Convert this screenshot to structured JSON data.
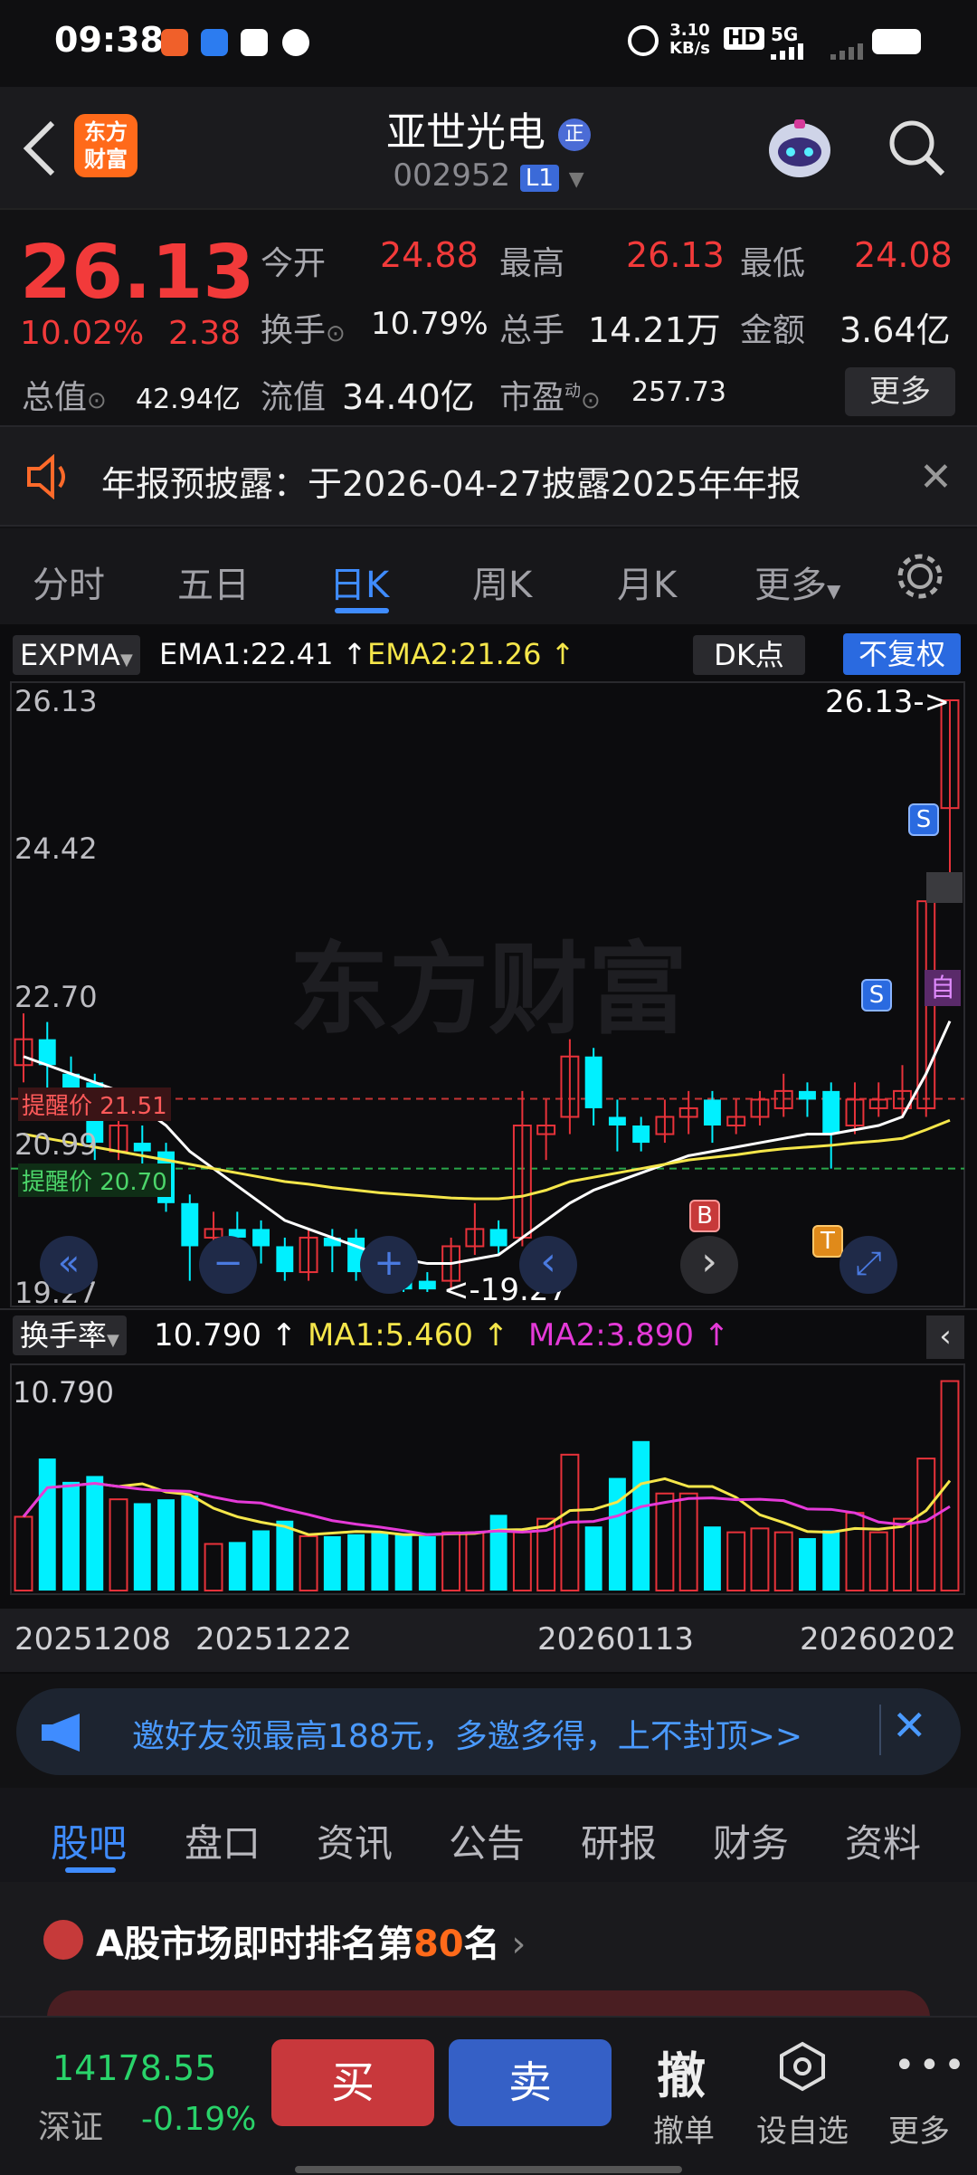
{
  "status_bar": {
    "time": "09:38",
    "net_speed_value": "3.10",
    "net_speed_unit": "KB/s",
    "hd": "HD",
    "signal": "5G"
  },
  "header": {
    "logo_line1": "东方",
    "logo_line2": "财富",
    "stock_name": "亚世光电",
    "badge": "正",
    "stock_code": "002952",
    "level": "L1"
  },
  "quote": {
    "price": "26.13",
    "change_pct": "10.02%",
    "change": "2.38",
    "open_label": "今开",
    "open": "24.88",
    "high_label": "最高",
    "high": "26.13",
    "low_label": "最低",
    "low": "24.08",
    "turnover_label": "换手",
    "turnover": "10.79%",
    "volume_label": "总手",
    "volume": "14.21万",
    "amount_label": "金额",
    "amount": "3.64亿",
    "mktcap_label": "总值",
    "mktcap": "42.94亿",
    "float_label": "流值",
    "float_cap": "34.40亿",
    "pe_label": "市盈",
    "pe_sup": "动",
    "pe": "257.73",
    "more_btn": "更多"
  },
  "notice": {
    "text": "年报预披露：于2026-04-27披露2025年年报"
  },
  "kline_tabs": [
    "分时",
    "五日",
    "日K",
    "周K",
    "月K",
    "更多"
  ],
  "kline_active": 2,
  "indicator": {
    "name": "EXPMA",
    "ema1": "EMA1:22.41",
    "ema2": "EMA2:21.26",
    "dk_label": "DK点",
    "adjust": "不复权",
    "price_ticks": [
      "26.13",
      "24.42",
      "22.70",
      "20.99",
      "19.27"
    ],
    "last_price_label": "26.13->",
    "min_label": "<-19.27",
    "alert1": "提醒价 21.51",
    "alert2": "提醒价 20.70",
    "watermark": "东方财富",
    "signal_labels": {
      "s": "S",
      "b": "B",
      "t": "T",
      "self": "自"
    },
    "colors": {
      "up": "#e8323a",
      "down": "#00f0ff",
      "ema1": "#ffffff",
      "ema2": "#f5e64a",
      "ma2": "#e53ad8"
    }
  },
  "sub_indicator": {
    "name": "换手率",
    "value": "10.790",
    "ma1": "MA1:5.460",
    "ma2": "MA2:3.890",
    "top_label": "10.790",
    "dates": [
      "20251208",
      "20251222",
      "20260113",
      "20260202"
    ]
  },
  "chart_data": {
    "type": "candlestick",
    "ylim": [
      19.27,
      26.13
    ],
    "candles": [
      {
        "o": 21.9,
        "c": 22.2,
        "h": 22.5,
        "l": 21.7
      },
      {
        "o": 22.2,
        "c": 21.9,
        "h": 22.4,
        "l": 21.6
      },
      {
        "o": 21.8,
        "c": 21.6,
        "h": 22.0,
        "l": 21.5
      },
      {
        "o": 21.7,
        "c": 21.0,
        "h": 21.8,
        "l": 20.8
      },
      {
        "o": 20.9,
        "c": 21.2,
        "h": 21.4,
        "l": 20.8
      },
      {
        "o": 21.0,
        "c": 20.9,
        "h": 21.2,
        "l": 20.7
      },
      {
        "o": 20.9,
        "c": 20.3,
        "h": 21.0,
        "l": 20.2
      },
      {
        "o": 20.3,
        "c": 19.8,
        "h": 20.4,
        "l": 19.4
      },
      {
        "o": 19.9,
        "c": 20.0,
        "h": 20.2,
        "l": 19.7
      },
      {
        "o": 20.0,
        "c": 19.9,
        "h": 20.2,
        "l": 19.7
      },
      {
        "o": 20.0,
        "c": 19.8,
        "h": 20.1,
        "l": 19.6
      },
      {
        "o": 19.8,
        "c": 19.5,
        "h": 19.9,
        "l": 19.4
      },
      {
        "o": 19.5,
        "c": 19.9,
        "h": 20.0,
        "l": 19.4
      },
      {
        "o": 19.9,
        "c": 19.8,
        "h": 20.0,
        "l": 19.5
      },
      {
        "o": 19.9,
        "c": 19.5,
        "h": 20.0,
        "l": 19.4
      },
      {
        "o": 19.6,
        "c": 19.5,
        "h": 19.7,
        "l": 19.3
      },
      {
        "o": 19.6,
        "c": 19.3,
        "h": 19.7,
        "l": 19.27
      },
      {
        "o": 19.4,
        "c": 19.3,
        "h": 19.5,
        "l": 19.27
      },
      {
        "o": 19.4,
        "c": 19.8,
        "h": 19.9,
        "l": 19.3
      },
      {
        "o": 19.8,
        "c": 20.0,
        "h": 20.3,
        "l": 19.7
      },
      {
        "o": 20.0,
        "c": 19.8,
        "h": 20.1,
        "l": 19.7
      },
      {
        "o": 19.9,
        "c": 21.2,
        "h": 21.6,
        "l": 19.8
      },
      {
        "o": 21.1,
        "c": 21.2,
        "h": 21.5,
        "l": 20.8
      },
      {
        "o": 21.3,
        "c": 22.0,
        "h": 22.2,
        "l": 21.1
      },
      {
        "o": 22.0,
        "c": 21.4,
        "h": 22.1,
        "l": 21.2
      },
      {
        "o": 21.3,
        "c": 21.2,
        "h": 21.5,
        "l": 20.9
      },
      {
        "o": 21.2,
        "c": 21.0,
        "h": 21.3,
        "l": 20.9
      },
      {
        "o": 21.1,
        "c": 21.3,
        "h": 21.5,
        "l": 21.0
      },
      {
        "o": 21.3,
        "c": 21.4,
        "h": 21.6,
        "l": 21.1
      },
      {
        "o": 21.5,
        "c": 21.2,
        "h": 21.6,
        "l": 21.0
      },
      {
        "o": 21.2,
        "c": 21.3,
        "h": 21.5,
        "l": 21.1
      },
      {
        "o": 21.3,
        "c": 21.5,
        "h": 21.6,
        "l": 21.2
      },
      {
        "o": 21.4,
        "c": 21.6,
        "h": 21.8,
        "l": 21.3
      },
      {
        "o": 21.6,
        "c": 21.5,
        "h": 21.7,
        "l": 21.3
      },
      {
        "o": 21.6,
        "c": 21.1,
        "h": 21.7,
        "l": 20.7
      },
      {
        "o": 21.2,
        "c": 21.5,
        "h": 21.7,
        "l": 21.1
      },
      {
        "o": 21.4,
        "c": 21.5,
        "h": 21.7,
        "l": 21.3
      },
      {
        "o": 21.4,
        "c": 21.6,
        "h": 21.9,
        "l": 21.3
      },
      {
        "o": 21.4,
        "c": 23.8,
        "h": 23.8,
        "l": 21.3
      },
      {
        "o": 24.88,
        "c": 26.13,
        "h": 26.13,
        "l": 24.08
      }
    ],
    "ema1": [
      22.0,
      21.9,
      21.8,
      21.7,
      21.6,
      21.4,
      21.2,
      20.9,
      20.7,
      20.5,
      20.3,
      20.1,
      20.0,
      19.9,
      19.8,
      19.7,
      19.65,
      19.6,
      19.6,
      19.65,
      19.7,
      19.9,
      20.1,
      20.3,
      20.45,
      20.55,
      20.65,
      20.75,
      20.85,
      20.9,
      20.95,
      21.0,
      21.05,
      21.1,
      21.1,
      21.15,
      21.2,
      21.3,
      21.8,
      22.41
    ],
    "ema2": [
      21.1,
      21.05,
      21.0,
      20.95,
      20.9,
      20.85,
      20.8,
      20.75,
      20.7,
      20.65,
      20.6,
      20.55,
      20.52,
      20.48,
      20.45,
      20.42,
      20.4,
      20.38,
      20.36,
      20.35,
      20.35,
      20.38,
      20.45,
      20.55,
      20.6,
      20.65,
      20.7,
      20.75,
      20.8,
      20.83,
      20.86,
      20.9,
      20.93,
      20.95,
      20.97,
      21.0,
      21.02,
      21.05,
      21.15,
      21.26
    ],
    "turnover": [
      3.8,
      6.8,
      5.6,
      5.9,
      4.7,
      4.5,
      4.7,
      4.9,
      2.4,
      2.5,
      3.1,
      3.6,
      2.8,
      2.8,
      2.9,
      3.0,
      2.9,
      2.8,
      3.0,
      3.0,
      3.9,
      3.0,
      3.7,
      7.0,
      3.3,
      5.8,
      7.7,
      5.0,
      5.0,
      3.3,
      3.0,
      3.2,
      3.0,
      2.7,
      3.1,
      4.0,
      3.0,
      3.7,
      6.8,
      10.79
    ]
  },
  "quick_actions": [
    {
      "name": "prev",
      "symbol": "«"
    },
    {
      "name": "zoom-out",
      "symbol": "−"
    },
    {
      "name": "zoom-in",
      "symbol": "+"
    },
    {
      "name": "left",
      "symbol": "‹"
    },
    {
      "name": "right",
      "symbol": "›"
    },
    {
      "name": "fullscreen",
      "symbol": "⤢"
    }
  ],
  "banner": {
    "text": "邀好友领最高188元，多邀多得，上不封顶>>"
  },
  "bottom_tabs": [
    "股吧",
    "盘口",
    "资讯",
    "公告",
    "研报",
    "财务",
    "资料"
  ],
  "rank": {
    "prefix": "A股市场即时排名第",
    "number": "80",
    "suffix": "名"
  },
  "bottom_bar": {
    "index_value": "14178.55",
    "index_name": "深证",
    "index_change": "-0.19%",
    "buy": "买",
    "sell": "卖",
    "cancel_icon": "撤",
    "cancel_label": "撤单",
    "watch_label": "设自选",
    "more_label": "更多"
  }
}
